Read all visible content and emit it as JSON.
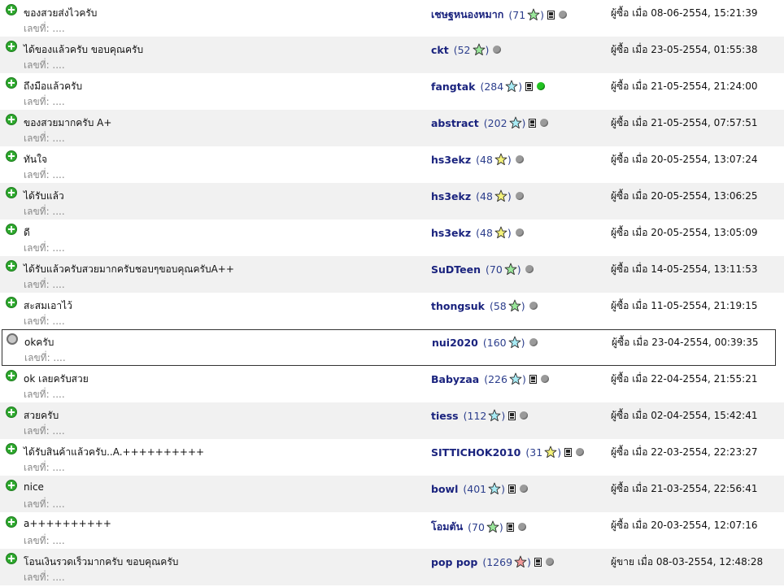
{
  "colors": {
    "positive_icon": "#2fa92f",
    "neutral_icon": "#c8c8c8",
    "username": "#1a237e",
    "row_alt_bg": "#f1f1f1",
    "online_dot": "#22c322",
    "offline_dot": "#9a9a9a"
  },
  "feedback": [
    {
      "type": "positive",
      "icon": "plus-icon",
      "comment": "ของสวยส่งไวครับ",
      "ref": "เลขที่: ....",
      "user": "เชษฐหนองหมาก",
      "score": "(71",
      "star": "green",
      "close": ")",
      "id_card": true,
      "online": false,
      "when": "ผู้ซื้อ เมื่อ 08-06-2554, 15:21:39"
    },
    {
      "type": "positive",
      "icon": "plus-icon",
      "comment": "ได้ของแล้วครับ ขอบคุณครับ",
      "ref": "เลขที่: ....",
      "user": "ckt",
      "score": "(52",
      "star": "green",
      "close": ")",
      "id_card": false,
      "online": false,
      "when": "ผู้ซื้อ เมื่อ 23-05-2554, 01:55:38"
    },
    {
      "type": "positive",
      "icon": "plus-icon",
      "comment": "ถึงมือแล้วครับ",
      "ref": "เลขที่: ....",
      "user": "fangtak",
      "score": "(284",
      "star": "cyan",
      "close": ")",
      "id_card": true,
      "online": true,
      "when": "ผู้ซื้อ เมื่อ 21-05-2554, 21:24:00"
    },
    {
      "type": "positive",
      "icon": "plus-icon",
      "comment": "ของสวยมากครับ A+",
      "ref": "เลขที่: ....",
      "user": "abstract",
      "score": "(202",
      "star": "cyan",
      "close": ")",
      "id_card": true,
      "online": false,
      "when": "ผู้ซื้อ เมื่อ 21-05-2554, 07:57:51"
    },
    {
      "type": "positive",
      "icon": "plus-icon",
      "comment": "ทันใจ",
      "ref": "เลขที่: ....",
      "user": "hs3ekz",
      "score": "(48",
      "star": "yellow",
      "close": ")",
      "id_card": false,
      "online": false,
      "when": "ผู้ซื้อ เมื่อ 20-05-2554, 13:07:24"
    },
    {
      "type": "positive",
      "icon": "plus-icon",
      "comment": "ได้รับแล้ว",
      "ref": "เลขที่: ....",
      "user": "hs3ekz",
      "score": "(48",
      "star": "yellow",
      "close": ")",
      "id_card": false,
      "online": false,
      "when": "ผู้ซื้อ เมื่อ 20-05-2554, 13:06:25"
    },
    {
      "type": "positive",
      "icon": "plus-icon",
      "comment": "ดี",
      "ref": "เลขที่: ....",
      "user": "hs3ekz",
      "score": "(48",
      "star": "yellow",
      "close": ")",
      "id_card": false,
      "online": false,
      "when": "ผู้ซื้อ เมื่อ 20-05-2554, 13:05:09"
    },
    {
      "type": "positive",
      "icon": "plus-icon",
      "comment": "ได้รับแล้วครับสวยมากครับชอบๆขอบคุณครับA++",
      "ref": "เลขที่: ....",
      "user": "SuDTeen",
      "score": "(70",
      "star": "green",
      "close": ")",
      "id_card": false,
      "online": false,
      "when": "ผู้ซื้อ เมื่อ 14-05-2554, 13:11:53"
    },
    {
      "type": "positive",
      "icon": "plus-icon",
      "comment": "สะสมเอาไว้",
      "ref": "เลขที่: ....",
      "user": "thongsuk",
      "score": "(58",
      "star": "green",
      "close": ")",
      "id_card": false,
      "online": false,
      "when": "ผู้ซื้อ เมื่อ 11-05-2554, 21:19:15"
    },
    {
      "type": "neutral",
      "icon": "neutral-circle-icon",
      "comment": "okครับ",
      "ref": "เลขที่: ....",
      "user": "nui2020",
      "score": "(160",
      "star": "cyan",
      "close": ")",
      "id_card": false,
      "online": false,
      "when": "ผู้ซื้อ เมื่อ 23-04-2554, 00:39:35"
    },
    {
      "type": "positive",
      "icon": "plus-icon",
      "comment": "ok เลยครับสวย",
      "ref": "เลขที่: ....",
      "user": "Babyzaa",
      "score": "(226",
      "star": "cyan",
      "close": ")",
      "id_card": true,
      "online": false,
      "when": "ผู้ซื้อ เมื่อ 22-04-2554, 21:55:21"
    },
    {
      "type": "positive",
      "icon": "plus-icon",
      "comment": "สวยครับ",
      "ref": "เลขที่: ....",
      "user": "tiess",
      "score": "(112",
      "star": "cyan",
      "close": ")",
      "id_card": true,
      "online": false,
      "when": "ผู้ซื้อ เมื่อ 02-04-2554, 15:42:41"
    },
    {
      "type": "positive",
      "icon": "plus-icon",
      "comment": "ได้รับสินค้าแล้วครับ..A.++++++++++",
      "ref": "เลขที่: ....",
      "user": "SITTICHOK2010",
      "score": "(31",
      "star": "yellow",
      "close": ")",
      "id_card": true,
      "online": false,
      "when": "ผู้ซื้อ เมื่อ 22-03-2554, 22:23:27"
    },
    {
      "type": "positive",
      "icon": "plus-icon",
      "comment": "nice",
      "ref": "เลขที่: ....",
      "user": "bowl",
      "score": "(401",
      "star": "cyan",
      "close": ")",
      "id_card": true,
      "online": false,
      "when": "ผู้ซื้อ เมื่อ 21-03-2554, 22:56:41"
    },
    {
      "type": "positive",
      "icon": "plus-icon",
      "comment": "a++++++++++",
      "ref": "เลขที่: ....",
      "user": "โอมตัน",
      "score": "(70",
      "star": "green",
      "close": ")",
      "id_card": true,
      "online": false,
      "when": "ผู้ซื้อ เมื่อ 20-03-2554, 12:07:16"
    },
    {
      "type": "positive",
      "icon": "plus-icon",
      "comment": "โอนเงินรวดเร็วมากครับ ขอบคุณครับ",
      "ref": "เลขที่: ....",
      "user": "pop pop",
      "score": "(1269",
      "star": "red",
      "close": ")",
      "id_card": true,
      "online": false,
      "when": "ผู้ขาย เมื่อ 08-03-2554, 12:48:28"
    }
  ]
}
